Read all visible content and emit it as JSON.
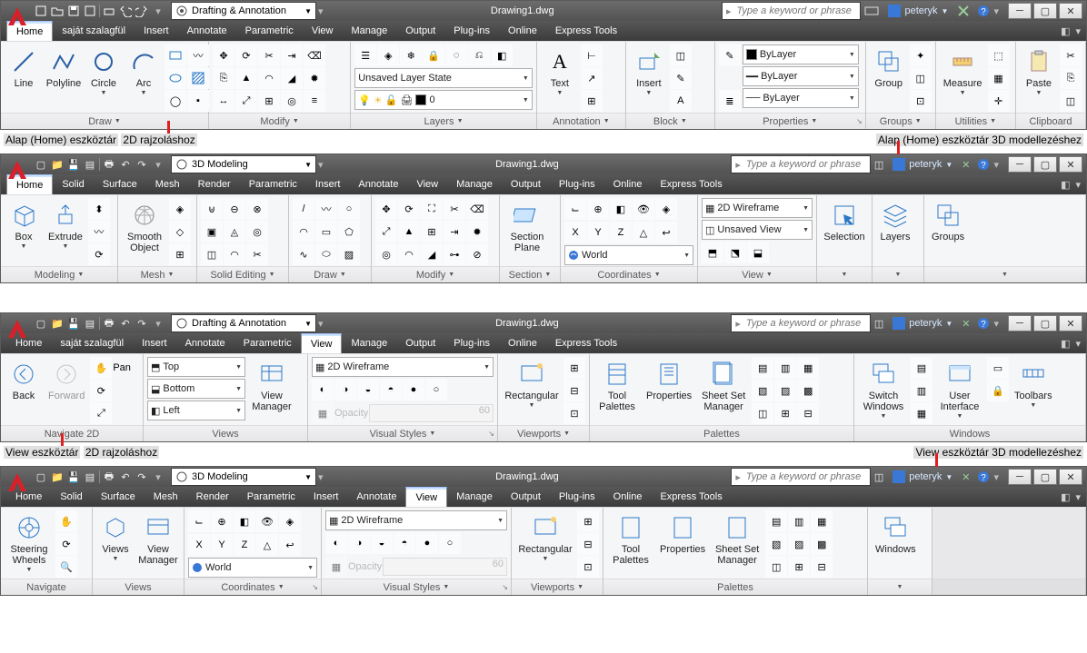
{
  "notes": {
    "n1a": "Alap (Home) eszköztár",
    "n1b": "2D rajzoláshoz",
    "n2": "Alap (Home) eszköztár 3D modellezéshez",
    "n3a": "View eszköztár",
    "n3b": "2D rajzoláshoz",
    "n4": "View eszköztár 3D modellezéshez"
  },
  "win1": {
    "workspace": "Drafting & Annotation",
    "title": "Drawing1.dwg",
    "search_ph": "Type a keyword or phrase",
    "user": "peteryk",
    "tabs": [
      "Home",
      "saját szalagfül",
      "Insert",
      "Annotate",
      "Parametric",
      "View",
      "Manage",
      "Output",
      "Plug-ins",
      "Online",
      "Express Tools"
    ],
    "active_tab": "Home",
    "panels": {
      "draw": {
        "title": "Draw",
        "btns": [
          "Line",
          "Polyline",
          "Circle",
          "Arc"
        ]
      },
      "modify": {
        "title": "Modify"
      },
      "layers": {
        "title": "Layers",
        "state": "Unsaved Layer State",
        "cur": "0"
      },
      "annotation": {
        "title": "Annotation",
        "btn": "Text"
      },
      "block": {
        "title": "Block",
        "btn": "Insert"
      },
      "properties": {
        "title": "Properties",
        "sel": "ByLayer",
        "lt": "ByLayer",
        "lw": "ByLayer"
      },
      "groups": {
        "title": "Groups",
        "btn": "Group"
      },
      "utilities": {
        "title": "Utilities",
        "btn": "Measure"
      },
      "clipboard": {
        "title": "Clipboard",
        "btn": "Paste"
      }
    }
  },
  "win2": {
    "workspace": "3D Modeling",
    "title": "Drawing1.dwg",
    "search_ph": "Type a keyword or phrase",
    "user": "peteryk",
    "tabs": [
      "Home",
      "Solid",
      "Surface",
      "Mesh",
      "Render",
      "Parametric",
      "Insert",
      "Annotate",
      "View",
      "Manage",
      "Output",
      "Plug-ins",
      "Online",
      "Express Tools"
    ],
    "active_tab": "Home",
    "panels": {
      "modeling": {
        "title": "Modeling",
        "b1": "Box",
        "b2": "Extrude"
      },
      "mesh": {
        "title": "Mesh",
        "btn": "Smooth Object"
      },
      "solid": {
        "title": "Solid Editing"
      },
      "draw": {
        "title": "Draw"
      },
      "modify": {
        "title": "Modify"
      },
      "section": {
        "title": "Section",
        "btn": "Section Plane"
      },
      "coords": {
        "title": "Coordinates",
        "world": "World"
      },
      "view": {
        "title": "View",
        "style": "2D Wireframe",
        "saved": "Unsaved View"
      },
      "selection": {
        "title": "Selection"
      },
      "layers": {
        "title": "Layers"
      },
      "groups": {
        "title": "Groups"
      }
    }
  },
  "win3": {
    "workspace": "Drafting & Annotation",
    "title": "Drawing1.dwg",
    "search_ph": "Type a keyword or phrase",
    "user": "peteryk",
    "tabs": [
      "Home",
      "saját szalagfül",
      "Insert",
      "Annotate",
      "Parametric",
      "View",
      "Manage",
      "Output",
      "Plug-ins",
      "Online",
      "Express Tools"
    ],
    "active_tab": "View",
    "panels": {
      "nav": {
        "title": "Navigate 2D",
        "back": "Back",
        "fwd": "Forward",
        "pan": "Pan"
      },
      "views": {
        "title": "Views",
        "top": "Top",
        "bottom": "Bottom",
        "left": "Left",
        "mgr": "View Manager"
      },
      "vstyles": {
        "title": "Visual Styles",
        "style": "2D Wireframe",
        "op": "Opacity",
        "opv": "60"
      },
      "viewports": {
        "title": "Viewports",
        "btn": "Rectangular"
      },
      "palettes": {
        "title": "Palettes",
        "b1": "Tool Palettes",
        "b2": "Properties",
        "b3": "Sheet Set Manager"
      },
      "windows": {
        "title": "Windows",
        "sw": "Switch Windows",
        "ui": "User Interface",
        "tb": "Toolbars"
      }
    }
  },
  "win4": {
    "workspace": "3D Modeling",
    "title": "Drawing1.dwg",
    "search_ph": "Type a keyword or phrase",
    "user": "peteryk",
    "tabs": [
      "Home",
      "Solid",
      "Surface",
      "Mesh",
      "Render",
      "Parametric",
      "Insert",
      "Annotate",
      "View",
      "Manage",
      "Output",
      "Plug-ins",
      "Online",
      "Express Tools"
    ],
    "active_tab": "View",
    "panels": {
      "nav": {
        "title": "Navigate",
        "btn": "Steering Wheels"
      },
      "views": {
        "title": "Views",
        "b1": "Views",
        "b2": "View Manager"
      },
      "coords": {
        "title": "Coordinates",
        "world": "World"
      },
      "vstyles": {
        "title": "Visual Styles",
        "style": "2D Wireframe",
        "op": "Opacity",
        "opv": "60"
      },
      "viewports": {
        "title": "Viewports",
        "btn": "Rectangular"
      },
      "palettes": {
        "title": "Palettes",
        "b1": "Tool Palettes",
        "b2": "Properties",
        "b3": "Sheet Set Manager"
      },
      "windows": {
        "title": "Windows",
        "btn": "Windows"
      }
    }
  }
}
